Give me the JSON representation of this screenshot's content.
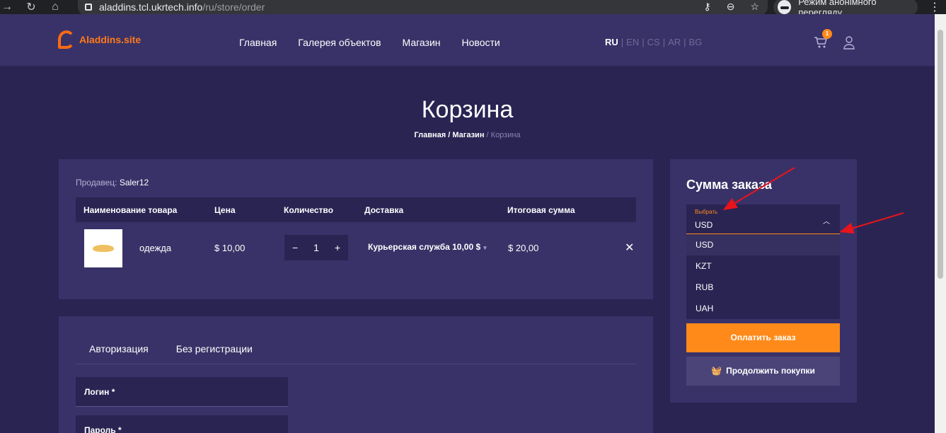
{
  "browser": {
    "url_host": "aladdins.tcl.ukrtech.info",
    "url_path": "/ru/store/order",
    "incognito_label": "Режим анонімного перегляду"
  },
  "header": {
    "logo_text": "Aladdins.site",
    "menu": [
      "Главная",
      "Галерея объектов",
      "Магазин",
      "Новости"
    ],
    "langs": [
      "RU",
      "EN",
      "CS",
      "AR",
      "BG"
    ],
    "active_lang": "RU",
    "cart_count": "1"
  },
  "page": {
    "title": "Корзина",
    "breadcrumb": [
      "Главная",
      "Магазин",
      "Корзина"
    ]
  },
  "cart": {
    "seller_label": "Продавец:",
    "seller_name": "Saler12",
    "columns": [
      "Наименование товара",
      "Цена",
      "Количество",
      "Доставка",
      "Итоговая сумма"
    ],
    "item": {
      "name": "одежда",
      "price": "$ 10,00",
      "qty": "1",
      "shipping": "Курьерская служба 10,00 $",
      "total": "$ 20,00"
    }
  },
  "auth": {
    "tabs": [
      "Авторизация",
      "Без регистрации"
    ],
    "login_label": "Логин *",
    "password_label": "Пароль *"
  },
  "summary": {
    "title": "Сумма заказа",
    "select_label": "Выбрать",
    "select_value": "USD",
    "options": [
      "USD",
      "KZT",
      "RUB",
      "UAH"
    ],
    "pay_button": "Оплатить заказ",
    "continue_button": "Продолжить покупки"
  },
  "colors": {
    "accent": "#ff8a1a",
    "panel": "#393268",
    "background": "#2a2453",
    "annotation_arrow": "#e8141b"
  }
}
